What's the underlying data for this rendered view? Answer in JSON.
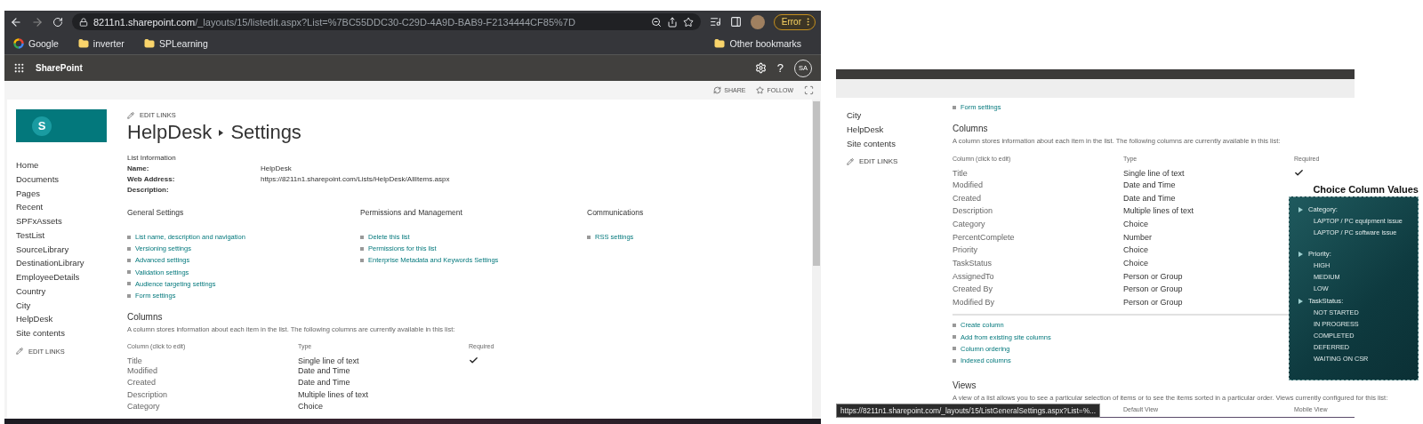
{
  "browser": {
    "url_host": "8211n1.sharepoint.com",
    "url_path": "/_layouts/15/listedit.aspx?List=%7BC55DDC30-C29D-4A9D-BAB9-F2134444CF85%7D",
    "error_button": "Error",
    "bookmarks": [
      {
        "label": "Google",
        "kind": "site"
      },
      {
        "label": "inverter",
        "kind": "folder"
      },
      {
        "label": "SPLearning",
        "kind": "folder"
      }
    ],
    "other_bookmarks": "Other bookmarks"
  },
  "suite_bar": {
    "app_name": "SharePoint",
    "help": "?",
    "avatar": "SA"
  },
  "page_actions": [
    "SHARE",
    "FOLLOW"
  ],
  "site": {
    "logo_letter": "S",
    "edit_links": "EDIT LINKS",
    "breadcrumb": [
      "HelpDesk",
      "Settings"
    ]
  },
  "nav": {
    "items": [
      "Home",
      "Documents",
      "Pages",
      "Recent",
      "SPFxAssets",
      "TestList",
      "SourceLibrary",
      "DestinationLibrary",
      "EmployeeDetails",
      "Country",
      "City",
      "HelpDesk",
      "Site contents"
    ],
    "edit_links": "EDIT LINKS"
  },
  "list_information": {
    "heading": "List Information",
    "fields": [
      {
        "label": "Name:",
        "value": "HelpDesk"
      },
      {
        "label": "Web Address:",
        "value": "https://8211n1.sharepoint.com/Lists/HelpDesk/AllItems.aspx"
      },
      {
        "label": "Description:"
      }
    ]
  },
  "sections": [
    {
      "heading": "General Settings",
      "links": [
        "List name, description and navigation",
        "Versioning settings",
        "Advanced settings",
        "Validation settings",
        "Audience targeting settings",
        "Form settings"
      ]
    },
    {
      "heading": "Permissions and Management",
      "links": [
        "Delete this list",
        "Permissions for this list",
        "Enterprise Metadata and Keywords Settings"
      ]
    },
    {
      "heading": "Communications",
      "links": [
        "RSS settings"
      ]
    }
  ],
  "columns": {
    "heading": "Columns",
    "description": "A column stores information about each item in the list. The following columns are currently available in this list:",
    "headers": [
      "Column (click to edit)",
      "Type",
      "Required"
    ],
    "rows": [
      {
        "name": "Title",
        "type": "Single line of text",
        "required": true
      },
      {
        "name": "Modified",
        "type": "Date and Time",
        "required": false
      },
      {
        "name": "Created",
        "type": "Date and Time",
        "required": false
      },
      {
        "name": "Description",
        "type": "Multiple lines of text",
        "required": false
      },
      {
        "name": "Category",
        "type": "Choice",
        "required": false
      }
    ]
  },
  "second_view": {
    "nav": {
      "items": [
        "City",
        "HelpDesk",
        "Site contents"
      ],
      "edit_links": "EDIT LINKS"
    },
    "top_link": "Form settings",
    "columns": {
      "heading": "Columns",
      "description": "A column stores information about each item in the list. The following columns are currently available in this list:",
      "headers": [
        "Column (click to edit)",
        "Type",
        "Required"
      ],
      "rows": [
        {
          "name": "Title",
          "type": "Single line of text",
          "required": true
        },
        {
          "name": "Modified",
          "type": "Date and Time",
          "required": false
        },
        {
          "name": "Created",
          "type": "Date and Time",
          "required": false
        },
        {
          "name": "Description",
          "type": "Multiple lines of text",
          "required": false
        },
        {
          "name": "Category",
          "type": "Choice",
          "required": false
        },
        {
          "name": "PercentComplete",
          "type": "Number",
          "required": false
        },
        {
          "name": "Priority",
          "type": "Choice",
          "required": false
        },
        {
          "name": "TaskStatus",
          "type": "Choice",
          "required": false
        },
        {
          "name": "AssignedTo",
          "type": "Person or Group",
          "required": false
        },
        {
          "name": "Created By",
          "type": "Person or Group",
          "required": false
        },
        {
          "name": "Modified By",
          "type": "Person or Group",
          "required": false
        }
      ],
      "links": [
        "Create column",
        "Add from existing site columns",
        "Column ordering",
        "Indexed columns"
      ]
    },
    "views": {
      "heading": "Views",
      "description": "A view of a list allows you to see a particular selection of items or to see the items sorted in a particular order. Views currently configured for this list:",
      "headers": [
        "Default View",
        "Mobile View"
      ]
    },
    "status_url": "https://8211n1.sharepoint.com/_layouts/15/ListGeneralSettings.aspx?List=%..."
  },
  "slide": {
    "title": "Choice Column Values",
    "groups": [
      {
        "heading": "Category:",
        "values": [
          "LAPTOP / PC equipment issue",
          "LAPTOP / PC software issue"
        ]
      },
      {
        "heading": "Priority:",
        "values": [
          "HIGH",
          "MEDIUM",
          "LOW"
        ]
      },
      {
        "heading": "TaskStatus:",
        "values": [
          "NOT STARTED",
          "IN PROGRESS",
          "COMPLETED",
          "DEFERRED",
          "WAITING ON CSR"
        ]
      }
    ]
  }
}
